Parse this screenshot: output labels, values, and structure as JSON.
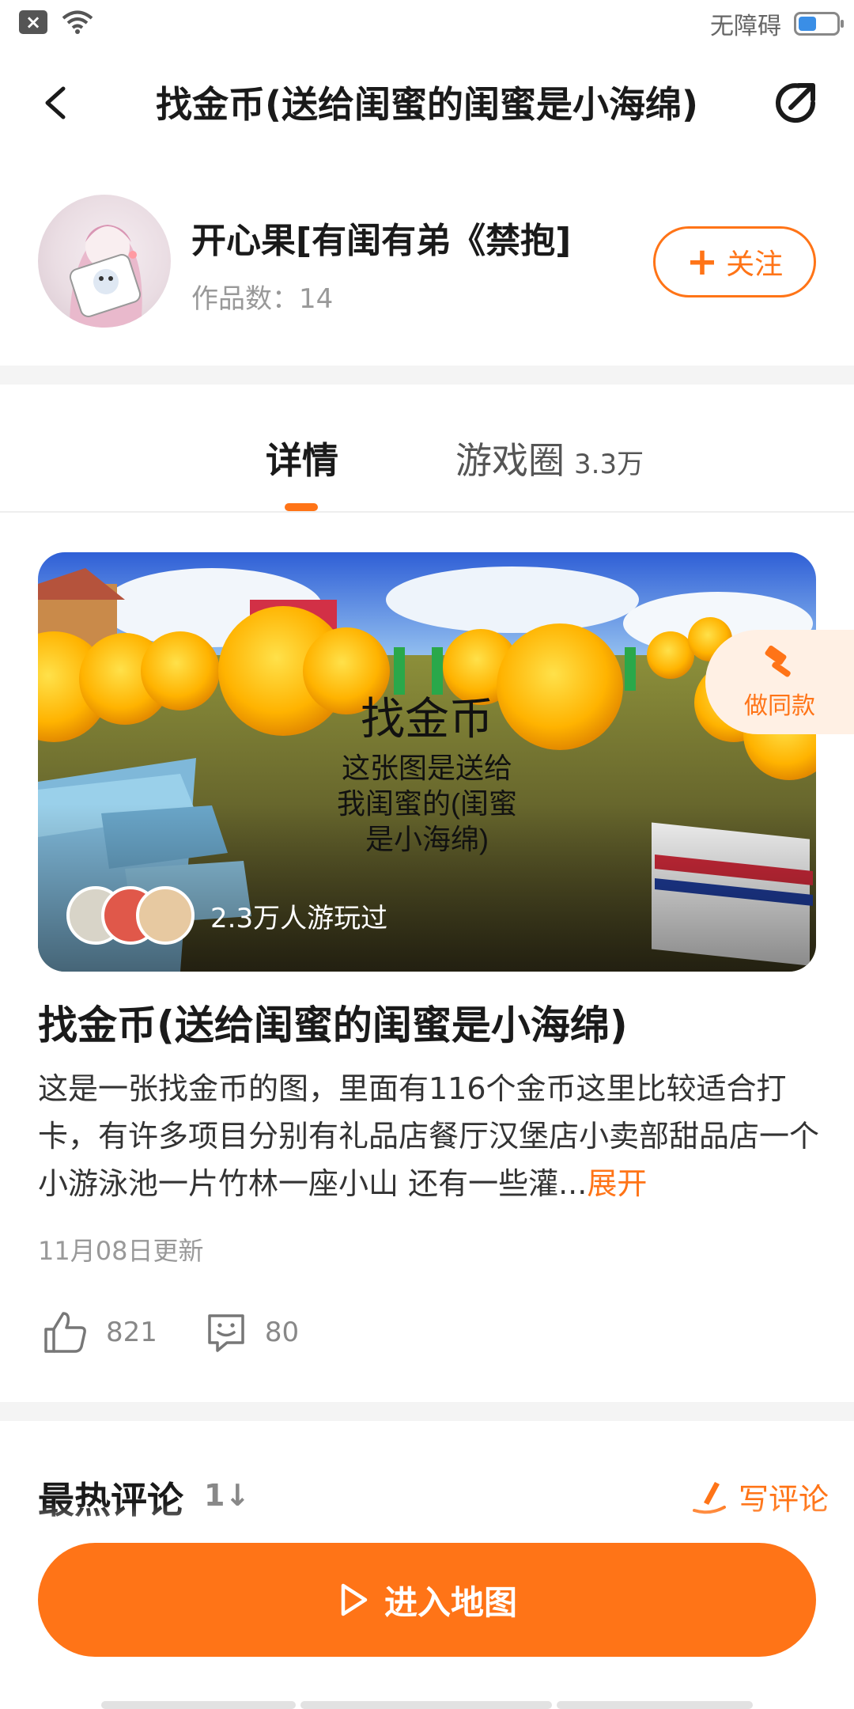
{
  "status_bar": {
    "accessibility_label": "无障碍",
    "battery_level_percent": 45,
    "icons": [
      "close-notification-icon",
      "wifi-icon",
      "battery-icon"
    ]
  },
  "header": {
    "title": "找金币(送给闺蜜的闺蜜是小海绵)",
    "back_icon": "back-arrow-icon",
    "share_icon": "share-icon"
  },
  "author": {
    "name": "开心果[有闺有弟《禁抱]",
    "works": "作品数：14",
    "follow_label": "关注"
  },
  "tabs": {
    "detail_label": "详情",
    "circle_label": "游戏圈",
    "circle_count": "3.3万"
  },
  "banner": {
    "players_text": "2.3万人游玩过"
  },
  "make_same": {
    "label": "做同款"
  },
  "game": {
    "title": "找金币(送给闺蜜的闺蜜是小海绵)",
    "description": "这是一张找金币的图，里面有116个金币这里比较适合打卡，有许多项目分别有礼品店餐厅汉堡店小卖部甜品店一个小游泳池一片竹林一座小山 还有一些灌...",
    "expand_label": "展开",
    "updated": "11月08日更新",
    "likes": "821",
    "comments": "80"
  },
  "comments": {
    "title": "最热评论",
    "sort_icon": "sort-icon",
    "write_label": "写评论"
  },
  "bottom": {
    "enter_label": "进入地图"
  },
  "colors": {
    "accent": "#ff7417",
    "text": "#1a1a1a",
    "muted": "#999999"
  }
}
